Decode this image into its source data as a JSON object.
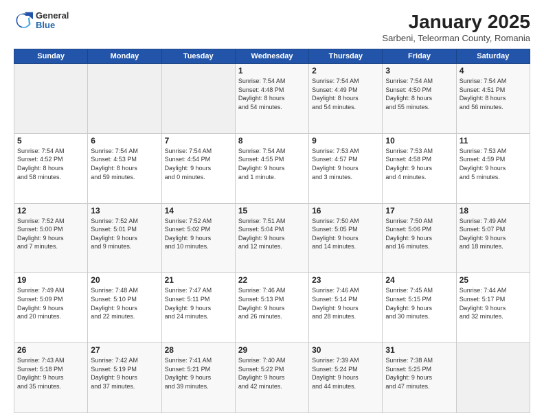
{
  "logo": {
    "general": "General",
    "blue": "Blue"
  },
  "title": "January 2025",
  "location": "Sarbeni, Teleorman County, Romania",
  "weekdays": [
    "Sunday",
    "Monday",
    "Tuesday",
    "Wednesday",
    "Thursday",
    "Friday",
    "Saturday"
  ],
  "weeks": [
    [
      {
        "day": "",
        "info": ""
      },
      {
        "day": "",
        "info": ""
      },
      {
        "day": "",
        "info": ""
      },
      {
        "day": "1",
        "info": "Sunrise: 7:54 AM\nSunset: 4:48 PM\nDaylight: 8 hours\nand 54 minutes."
      },
      {
        "day": "2",
        "info": "Sunrise: 7:54 AM\nSunset: 4:49 PM\nDaylight: 8 hours\nand 54 minutes."
      },
      {
        "day": "3",
        "info": "Sunrise: 7:54 AM\nSunset: 4:50 PM\nDaylight: 8 hours\nand 55 minutes."
      },
      {
        "day": "4",
        "info": "Sunrise: 7:54 AM\nSunset: 4:51 PM\nDaylight: 8 hours\nand 56 minutes."
      }
    ],
    [
      {
        "day": "5",
        "info": "Sunrise: 7:54 AM\nSunset: 4:52 PM\nDaylight: 8 hours\nand 58 minutes."
      },
      {
        "day": "6",
        "info": "Sunrise: 7:54 AM\nSunset: 4:53 PM\nDaylight: 8 hours\nand 59 minutes."
      },
      {
        "day": "7",
        "info": "Sunrise: 7:54 AM\nSunset: 4:54 PM\nDaylight: 9 hours\nand 0 minutes."
      },
      {
        "day": "8",
        "info": "Sunrise: 7:54 AM\nSunset: 4:55 PM\nDaylight: 9 hours\nand 1 minute."
      },
      {
        "day": "9",
        "info": "Sunrise: 7:53 AM\nSunset: 4:57 PM\nDaylight: 9 hours\nand 3 minutes."
      },
      {
        "day": "10",
        "info": "Sunrise: 7:53 AM\nSunset: 4:58 PM\nDaylight: 9 hours\nand 4 minutes."
      },
      {
        "day": "11",
        "info": "Sunrise: 7:53 AM\nSunset: 4:59 PM\nDaylight: 9 hours\nand 5 minutes."
      }
    ],
    [
      {
        "day": "12",
        "info": "Sunrise: 7:52 AM\nSunset: 5:00 PM\nDaylight: 9 hours\nand 7 minutes."
      },
      {
        "day": "13",
        "info": "Sunrise: 7:52 AM\nSunset: 5:01 PM\nDaylight: 9 hours\nand 9 minutes."
      },
      {
        "day": "14",
        "info": "Sunrise: 7:52 AM\nSunset: 5:02 PM\nDaylight: 9 hours\nand 10 minutes."
      },
      {
        "day": "15",
        "info": "Sunrise: 7:51 AM\nSunset: 5:04 PM\nDaylight: 9 hours\nand 12 minutes."
      },
      {
        "day": "16",
        "info": "Sunrise: 7:50 AM\nSunset: 5:05 PM\nDaylight: 9 hours\nand 14 minutes."
      },
      {
        "day": "17",
        "info": "Sunrise: 7:50 AM\nSunset: 5:06 PM\nDaylight: 9 hours\nand 16 minutes."
      },
      {
        "day": "18",
        "info": "Sunrise: 7:49 AM\nSunset: 5:07 PM\nDaylight: 9 hours\nand 18 minutes."
      }
    ],
    [
      {
        "day": "19",
        "info": "Sunrise: 7:49 AM\nSunset: 5:09 PM\nDaylight: 9 hours\nand 20 minutes."
      },
      {
        "day": "20",
        "info": "Sunrise: 7:48 AM\nSunset: 5:10 PM\nDaylight: 9 hours\nand 22 minutes."
      },
      {
        "day": "21",
        "info": "Sunrise: 7:47 AM\nSunset: 5:11 PM\nDaylight: 9 hours\nand 24 minutes."
      },
      {
        "day": "22",
        "info": "Sunrise: 7:46 AM\nSunset: 5:13 PM\nDaylight: 9 hours\nand 26 minutes."
      },
      {
        "day": "23",
        "info": "Sunrise: 7:46 AM\nSunset: 5:14 PM\nDaylight: 9 hours\nand 28 minutes."
      },
      {
        "day": "24",
        "info": "Sunrise: 7:45 AM\nSunset: 5:15 PM\nDaylight: 9 hours\nand 30 minutes."
      },
      {
        "day": "25",
        "info": "Sunrise: 7:44 AM\nSunset: 5:17 PM\nDaylight: 9 hours\nand 32 minutes."
      }
    ],
    [
      {
        "day": "26",
        "info": "Sunrise: 7:43 AM\nSunset: 5:18 PM\nDaylight: 9 hours\nand 35 minutes."
      },
      {
        "day": "27",
        "info": "Sunrise: 7:42 AM\nSunset: 5:19 PM\nDaylight: 9 hours\nand 37 minutes."
      },
      {
        "day": "28",
        "info": "Sunrise: 7:41 AM\nSunset: 5:21 PM\nDaylight: 9 hours\nand 39 minutes."
      },
      {
        "day": "29",
        "info": "Sunrise: 7:40 AM\nSunset: 5:22 PM\nDaylight: 9 hours\nand 42 minutes."
      },
      {
        "day": "30",
        "info": "Sunrise: 7:39 AM\nSunset: 5:24 PM\nDaylight: 9 hours\nand 44 minutes."
      },
      {
        "day": "31",
        "info": "Sunrise: 7:38 AM\nSunset: 5:25 PM\nDaylight: 9 hours\nand 47 minutes."
      },
      {
        "day": "",
        "info": ""
      }
    ]
  ]
}
